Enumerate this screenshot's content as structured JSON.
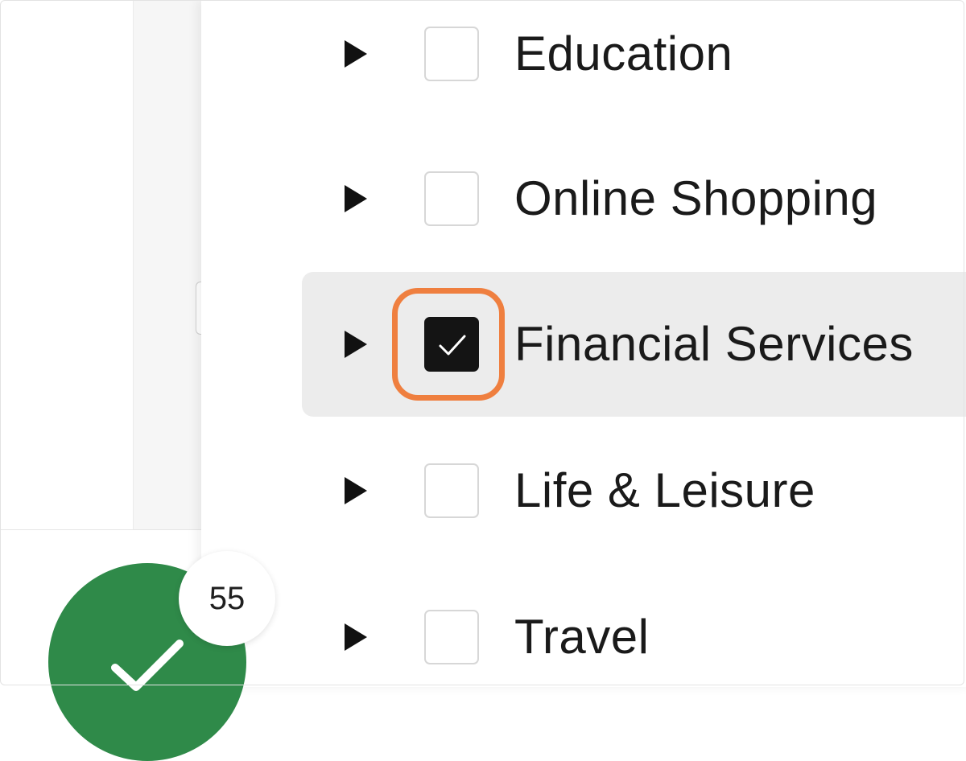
{
  "categories": [
    {
      "label": "Education",
      "checked": false,
      "selected": false
    },
    {
      "label": "Online Shopping",
      "checked": false,
      "selected": false
    },
    {
      "label": "Financial Services",
      "checked": true,
      "selected": true
    },
    {
      "label": "Life & Leisure",
      "checked": false,
      "selected": false
    },
    {
      "label": "Travel",
      "checked": false,
      "selected": false
    }
  ],
  "status_button": {
    "icon": "checkmark-icon",
    "color": "#2f8a49",
    "badge_count": "55"
  },
  "colors": {
    "focus_ring": "#ef7f3f",
    "selected_row_bg": "#ececec",
    "checkbox_checked": "#141414"
  },
  "icons": {
    "expand": "triangle-right-icon",
    "check": "checkmark-icon"
  }
}
